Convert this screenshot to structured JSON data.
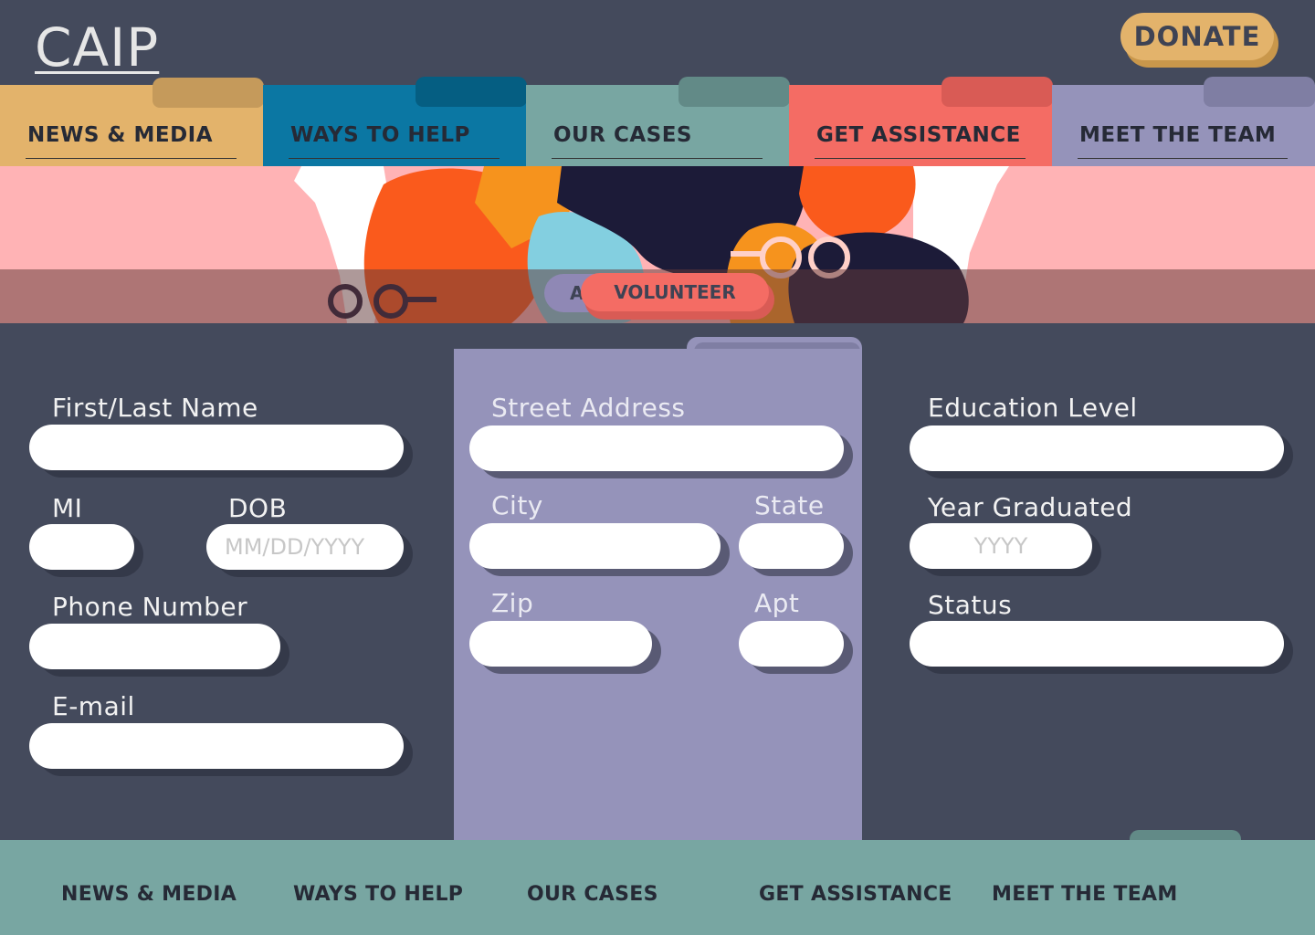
{
  "header": {
    "logo": "CAIP",
    "donate_label": "DONATE"
  },
  "nav": {
    "tabs": [
      {
        "label": "NEWS & MEDIA"
      },
      {
        "label": "WAYS TO HELP"
      },
      {
        "label": "OUR CASES"
      },
      {
        "label": "GET ASSISTANCE"
      },
      {
        "label": "MEET THE TEAM"
      }
    ]
  },
  "hero": {
    "hidden_button_partial": "A",
    "volunteer_label": "VOLUNTEER"
  },
  "form": {
    "name_label": "First/Last Name",
    "mi_label": "MI",
    "dob_label": "DOB",
    "dob_placeholder": "MM/DD/YYYY",
    "phone_label": "Phone Number",
    "email_label": "E-mail",
    "street_label": "Street Address",
    "city_label": "City",
    "state_label": "State",
    "zip_label": "Zip",
    "apt_label": "Apt",
    "education_label": "Education Level",
    "year_label": "Year Graduated",
    "year_placeholder": "YYYY",
    "status_label": "Status"
  },
  "footer": {
    "links": [
      {
        "label": "NEWS & MEDIA"
      },
      {
        "label": "WAYS TO HELP"
      },
      {
        "label": "OUR CASES"
      },
      {
        "label": "GET ASSISTANCE"
      },
      {
        "label": "MEET THE TEAM"
      }
    ]
  },
  "colors": {
    "background": "#444a5c",
    "gold": "#e3b36b",
    "blue": "#0b77a3",
    "teal": "#78a6a2",
    "coral": "#f46c64",
    "lavender": "#9593ba",
    "hero_pink": "#ffb3b5"
  }
}
